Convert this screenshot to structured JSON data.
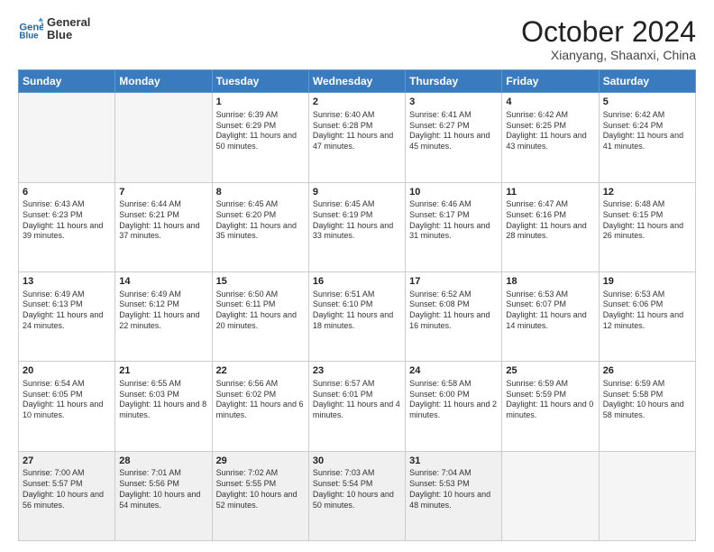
{
  "header": {
    "logo_line1": "General",
    "logo_line2": "Blue",
    "month": "October 2024",
    "location": "Xianyang, Shaanxi, China"
  },
  "weekdays": [
    "Sunday",
    "Monday",
    "Tuesday",
    "Wednesday",
    "Thursday",
    "Friday",
    "Saturday"
  ],
  "weeks": [
    [
      {
        "day": "",
        "text": ""
      },
      {
        "day": "",
        "text": ""
      },
      {
        "day": "1",
        "text": "Sunrise: 6:39 AM\nSunset: 6:29 PM\nDaylight: 11 hours and 50 minutes."
      },
      {
        "day": "2",
        "text": "Sunrise: 6:40 AM\nSunset: 6:28 PM\nDaylight: 11 hours and 47 minutes."
      },
      {
        "day": "3",
        "text": "Sunrise: 6:41 AM\nSunset: 6:27 PM\nDaylight: 11 hours and 45 minutes."
      },
      {
        "day": "4",
        "text": "Sunrise: 6:42 AM\nSunset: 6:25 PM\nDaylight: 11 hours and 43 minutes."
      },
      {
        "day": "5",
        "text": "Sunrise: 6:42 AM\nSunset: 6:24 PM\nDaylight: 11 hours and 41 minutes."
      }
    ],
    [
      {
        "day": "6",
        "text": "Sunrise: 6:43 AM\nSunset: 6:23 PM\nDaylight: 11 hours and 39 minutes."
      },
      {
        "day": "7",
        "text": "Sunrise: 6:44 AM\nSunset: 6:21 PM\nDaylight: 11 hours and 37 minutes."
      },
      {
        "day": "8",
        "text": "Sunrise: 6:45 AM\nSunset: 6:20 PM\nDaylight: 11 hours and 35 minutes."
      },
      {
        "day": "9",
        "text": "Sunrise: 6:45 AM\nSunset: 6:19 PM\nDaylight: 11 hours and 33 minutes."
      },
      {
        "day": "10",
        "text": "Sunrise: 6:46 AM\nSunset: 6:17 PM\nDaylight: 11 hours and 31 minutes."
      },
      {
        "day": "11",
        "text": "Sunrise: 6:47 AM\nSunset: 6:16 PM\nDaylight: 11 hours and 28 minutes."
      },
      {
        "day": "12",
        "text": "Sunrise: 6:48 AM\nSunset: 6:15 PM\nDaylight: 11 hours and 26 minutes."
      }
    ],
    [
      {
        "day": "13",
        "text": "Sunrise: 6:49 AM\nSunset: 6:13 PM\nDaylight: 11 hours and 24 minutes."
      },
      {
        "day": "14",
        "text": "Sunrise: 6:49 AM\nSunset: 6:12 PM\nDaylight: 11 hours and 22 minutes."
      },
      {
        "day": "15",
        "text": "Sunrise: 6:50 AM\nSunset: 6:11 PM\nDaylight: 11 hours and 20 minutes."
      },
      {
        "day": "16",
        "text": "Sunrise: 6:51 AM\nSunset: 6:10 PM\nDaylight: 11 hours and 18 minutes."
      },
      {
        "day": "17",
        "text": "Sunrise: 6:52 AM\nSunset: 6:08 PM\nDaylight: 11 hours and 16 minutes."
      },
      {
        "day": "18",
        "text": "Sunrise: 6:53 AM\nSunset: 6:07 PM\nDaylight: 11 hours and 14 minutes."
      },
      {
        "day": "19",
        "text": "Sunrise: 6:53 AM\nSunset: 6:06 PM\nDaylight: 11 hours and 12 minutes."
      }
    ],
    [
      {
        "day": "20",
        "text": "Sunrise: 6:54 AM\nSunset: 6:05 PM\nDaylight: 11 hours and 10 minutes."
      },
      {
        "day": "21",
        "text": "Sunrise: 6:55 AM\nSunset: 6:03 PM\nDaylight: 11 hours and 8 minutes."
      },
      {
        "day": "22",
        "text": "Sunrise: 6:56 AM\nSunset: 6:02 PM\nDaylight: 11 hours and 6 minutes."
      },
      {
        "day": "23",
        "text": "Sunrise: 6:57 AM\nSunset: 6:01 PM\nDaylight: 11 hours and 4 minutes."
      },
      {
        "day": "24",
        "text": "Sunrise: 6:58 AM\nSunset: 6:00 PM\nDaylight: 11 hours and 2 minutes."
      },
      {
        "day": "25",
        "text": "Sunrise: 6:59 AM\nSunset: 5:59 PM\nDaylight: 11 hours and 0 minutes."
      },
      {
        "day": "26",
        "text": "Sunrise: 6:59 AM\nSunset: 5:58 PM\nDaylight: 10 hours and 58 minutes."
      }
    ],
    [
      {
        "day": "27",
        "text": "Sunrise: 7:00 AM\nSunset: 5:57 PM\nDaylight: 10 hours and 56 minutes."
      },
      {
        "day": "28",
        "text": "Sunrise: 7:01 AM\nSunset: 5:56 PM\nDaylight: 10 hours and 54 minutes."
      },
      {
        "day": "29",
        "text": "Sunrise: 7:02 AM\nSunset: 5:55 PM\nDaylight: 10 hours and 52 minutes."
      },
      {
        "day": "30",
        "text": "Sunrise: 7:03 AM\nSunset: 5:54 PM\nDaylight: 10 hours and 50 minutes."
      },
      {
        "day": "31",
        "text": "Sunrise: 7:04 AM\nSunset: 5:53 PM\nDaylight: 10 hours and 48 minutes."
      },
      {
        "day": "",
        "text": ""
      },
      {
        "day": "",
        "text": ""
      }
    ]
  ]
}
